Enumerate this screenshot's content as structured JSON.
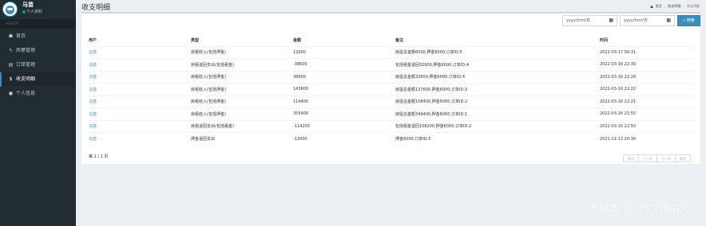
{
  "user": {
    "name": "马苗",
    "status": "个人资料"
  },
  "sidebar": {
    "header": "HEADER",
    "items": [
      {
        "label": "首页",
        "icon": "dashboard-icon",
        "glyph": "☗"
      },
      {
        "label": "房屋管理",
        "icon": "edit-icon",
        "glyph": "✎"
      },
      {
        "label": "订单管理",
        "icon": "file-icon",
        "glyph": "▤"
      },
      {
        "label": "收支明细",
        "icon": "dollar-icon",
        "glyph": "$"
      },
      {
        "label": "个人信息",
        "icon": "user-icon",
        "glyph": "●"
      }
    ]
  },
  "page": {
    "title": "收支明细"
  },
  "breadcrumb": {
    "home": "首页",
    "parent": "收支明细",
    "current": "收支明细"
  },
  "filter": {
    "start_placeholder": "yyyy/mm/日",
    "end_placeholder": "yyyy/mm/日",
    "search_label": "搜索"
  },
  "table": {
    "headers": {
      "user": "用户",
      "type": "类型",
      "amount": "金额",
      "remark": "备注",
      "time": "时间"
    },
    "rows": [
      {
        "user": "马苗",
        "type": "房租收入(包括押金)",
        "amount": "12000",
        "remark": "房屋总金额6000,押金6000,订单ID:5",
        "time": "2022-03-17 00:31"
      },
      {
        "user": "马苗",
        "type": "房租退回支出(包括租金)",
        "amount": "-38600",
        "remark": "包括租金退回32600,押金6000,订单ID:4",
        "time": "2022-03-16 22:30"
      },
      {
        "user": "马苗",
        "type": "房租收入(包括押金)",
        "amount": "38600",
        "remark": "房屋总金额32600,押金6000,订单ID:4",
        "time": "2022-03-16 22:28"
      },
      {
        "user": "马苗",
        "type": "房租收入(包括押金)",
        "amount": "143600",
        "remark": "房屋总金额137600,押金6000,订单ID:3",
        "time": "2022-03-16 22:22"
      },
      {
        "user": "马苗",
        "type": "房租收入(包括押金)",
        "amount": "114400",
        "remark": "房屋总金额108400,押金6000,订单ID:2",
        "time": "2022-03-16 22:21"
      },
      {
        "user": "马苗",
        "type": "房租收入(包括押金)",
        "amount": "355400",
        "remark": "房屋总金额349400,押金6000,订单ID:1",
        "time": "2022-03-16 21:55"
      },
      {
        "user": "马苗",
        "type": "房租退回支出(包括租金)",
        "amount": "-114200",
        "remark": "包括租金退回108200,押金6000,订单ID:2",
        "time": "2022-03-15 22:50"
      },
      {
        "user": "马苗",
        "type": "押金退回支出",
        "amount": "-12000",
        "remark": "押金6000,订单ID:5",
        "time": "2021-11-13 20:30"
      }
    ]
  },
  "pagination": {
    "info": "第 1 / 1 页",
    "first": "首页",
    "prev": "上一页",
    "next": "下一页",
    "last": "尾页"
  },
  "watermark": "CSDN @张家的鱼摆摆",
  "colors": {
    "sidebar_bg": "#222d32",
    "accent": "#3c8dbc",
    "content_bg": "#ecf0f5"
  }
}
